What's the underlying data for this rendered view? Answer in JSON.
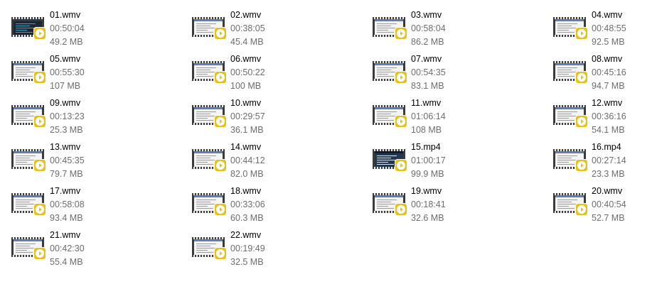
{
  "colors": {
    "badge": "#e8c21b",
    "name_text": "#000000",
    "detail_text": "#6d6d6d",
    "background": "#ffffff"
  },
  "icon": "video-file-thumbnail-icon",
  "files": [
    {
      "name": "01.wmv",
      "duration": "00:50:04",
      "size": "49.2 MB",
      "thumb": "dark"
    },
    {
      "name": "02.wmv",
      "duration": "00:38:05",
      "size": "45.4 MB",
      "thumb": "light"
    },
    {
      "name": "03.wmv",
      "duration": "00:58:04",
      "size": "86.2 MB",
      "thumb": "light"
    },
    {
      "name": "04.wmv",
      "duration": "00:48:55",
      "size": "92.5 MB",
      "thumb": "light"
    },
    {
      "name": "05.wmv",
      "duration": "00:55:30",
      "size": "107 MB",
      "thumb": "light"
    },
    {
      "name": "06.wmv",
      "duration": "00:50:22",
      "size": "100 MB",
      "thumb": "light"
    },
    {
      "name": "07.wmv",
      "duration": "00:54:35",
      "size": "83.1 MB",
      "thumb": "light"
    },
    {
      "name": "08.wmv",
      "duration": "00:45:16",
      "size": "94.7 MB",
      "thumb": "light"
    },
    {
      "name": "09.wmv",
      "duration": "00:13:23",
      "size": "25.3 MB",
      "thumb": "light"
    },
    {
      "name": "10.wmv",
      "duration": "00:29:57",
      "size": "36.1 MB",
      "thumb": "light"
    },
    {
      "name": "11.wmv",
      "duration": "01:06:14",
      "size": "108 MB",
      "thumb": "light"
    },
    {
      "name": "12.wmv",
      "duration": "00:36:16",
      "size": "54.1 MB",
      "thumb": "light"
    },
    {
      "name": "13.wmv",
      "duration": "00:45:35",
      "size": "79.7 MB",
      "thumb": "light"
    },
    {
      "name": "14.wmv",
      "duration": "00:44:12",
      "size": "82.0 MB",
      "thumb": "light"
    },
    {
      "name": "15.mp4",
      "duration": "01:00:17",
      "size": "99.9 MB",
      "thumb": "navy"
    },
    {
      "name": "16.mp4",
      "duration": "00:27:14",
      "size": "23.3 MB",
      "thumb": "light"
    },
    {
      "name": "17.wmv",
      "duration": "00:58:08",
      "size": "93.4 MB",
      "thumb": "light"
    },
    {
      "name": "18.wmv",
      "duration": "00:33:06",
      "size": "60.3 MB",
      "thumb": "light"
    },
    {
      "name": "19.wmv",
      "duration": "00:18:41",
      "size": "32.6 MB",
      "thumb": "light"
    },
    {
      "name": "20.wmv",
      "duration": "00:40:54",
      "size": "52.7 MB",
      "thumb": "light"
    },
    {
      "name": "21.wmv",
      "duration": "00:42:30",
      "size": "55.4 MB",
      "thumb": "light"
    },
    {
      "name": "22.wmv",
      "duration": "00:19:49",
      "size": "32.5 MB",
      "thumb": "light"
    }
  ]
}
